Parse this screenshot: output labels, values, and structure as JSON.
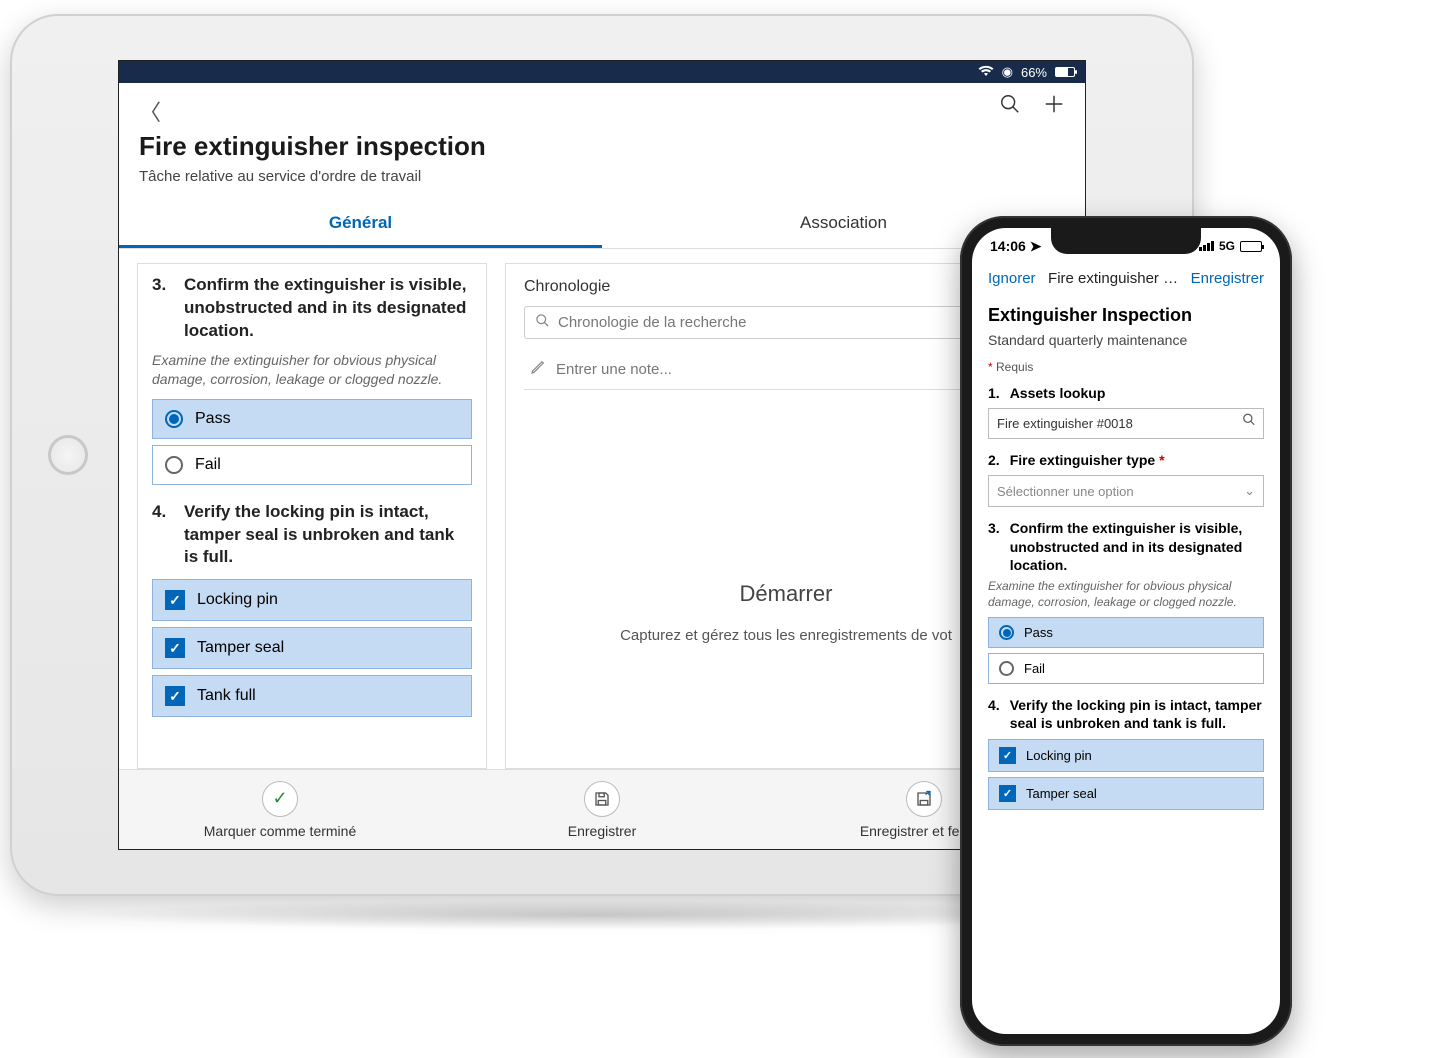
{
  "tablet": {
    "status": {
      "battery_pct": "66%"
    },
    "header": {
      "title": "Fire extinguisher inspection",
      "subtitle": "Tâche relative au service d'ordre de travail"
    },
    "tabs": {
      "general": "Général",
      "association": "Association"
    },
    "questions": {
      "q3": {
        "num": "3.",
        "text": "Confirm the extinguisher is visible, unobstructed and in its designated location.",
        "desc": "Examine the extinguisher for obvious physical damage, corrosion, leakage or clogged nozzle.",
        "opt_pass": "Pass",
        "opt_fail": "Fail"
      },
      "q4": {
        "num": "4.",
        "text": "Verify the locking pin is intact, tamper seal is unbroken and tank is full.",
        "opt_a": "Locking pin",
        "opt_b": "Tamper seal",
        "opt_c": "Tank full"
      }
    },
    "timeline": {
      "heading": "Chronologie",
      "search_placeholder": "Chronologie de la recherche",
      "note_placeholder": "Entrer une note...",
      "start_title": "Démarrer",
      "start_desc": "Capturez et gérez tous les enregistrements de vot"
    },
    "actions": {
      "complete": "Marquer comme terminé",
      "save": "Enregistrer",
      "save_close": "Enregistrer et fermer"
    }
  },
  "phone": {
    "status": {
      "time": "14:06",
      "net": "5G"
    },
    "topbar": {
      "ignore": "Ignorer",
      "title": "Fire extinguisher …",
      "save": "Enregistrer"
    },
    "title": "Extinguisher Inspection",
    "subtitle": "Standard quarterly maintenance",
    "required_label": "Requis",
    "questions": {
      "q1": {
        "num": "1.",
        "text": "Assets lookup",
        "value": "Fire extinguisher #0018"
      },
      "q2": {
        "num": "2.",
        "text": "Fire extinguisher type",
        "placeholder": "Sélectionner une option"
      },
      "q3": {
        "num": "3.",
        "text": "Confirm the extinguisher is visible, unobstructed and in its designated location.",
        "desc": "Examine the extinguisher for obvious physical damage, corrosion, leakage or clogged nozzle.",
        "opt_pass": "Pass",
        "opt_fail": "Fail"
      },
      "q4": {
        "num": "4.",
        "text": "Verify the locking pin is intact, tamper seal is unbroken and tank is full.",
        "opt_a": "Locking pin",
        "opt_b": "Tamper seal"
      }
    }
  }
}
